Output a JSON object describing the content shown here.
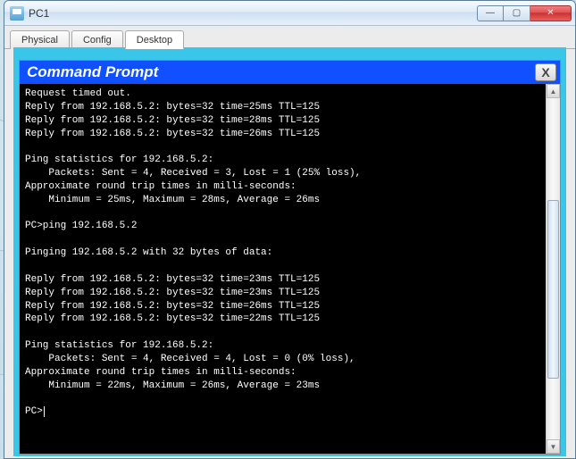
{
  "window": {
    "title": "PC1",
    "buttons": {
      "min": "—",
      "max": "▢",
      "close": "✕"
    }
  },
  "tabs": {
    "physical": "Physical",
    "config": "Config",
    "desktop": "Desktop"
  },
  "cmd": {
    "title": "Command Prompt",
    "close": "X",
    "lines": [
      "Request timed out.",
      "Reply from 192.168.5.2: bytes=32 time=25ms TTL=125",
      "Reply from 192.168.5.2: bytes=32 time=28ms TTL=125",
      "Reply from 192.168.5.2: bytes=32 time=26ms TTL=125",
      "",
      "Ping statistics for 192.168.5.2:",
      "    Packets: Sent = 4, Received = 3, Lost = 1 (25% loss),",
      "Approximate round trip times in milli-seconds:",
      "    Minimum = 25ms, Maximum = 28ms, Average = 26ms",
      "",
      "PC>ping 192.168.5.2",
      "",
      "Pinging 192.168.5.2 with 32 bytes of data:",
      "",
      "Reply from 192.168.5.2: bytes=32 time=23ms TTL=125",
      "Reply from 192.168.5.2: bytes=32 time=23ms TTL=125",
      "Reply from 192.168.5.2: bytes=32 time=26ms TTL=125",
      "Reply from 192.168.5.2: bytes=32 time=22ms TTL=125",
      "",
      "Ping statistics for 192.168.5.2:",
      "    Packets: Sent = 4, Received = 4, Lost = 0 (0% loss),",
      "Approximate round trip times in milli-seconds:",
      "    Minimum = 22ms, Maximum = 26ms, Average = 23ms",
      ""
    ],
    "prompt": "PC>"
  },
  "scrollbar": {
    "up": "▲",
    "down": "▼"
  }
}
